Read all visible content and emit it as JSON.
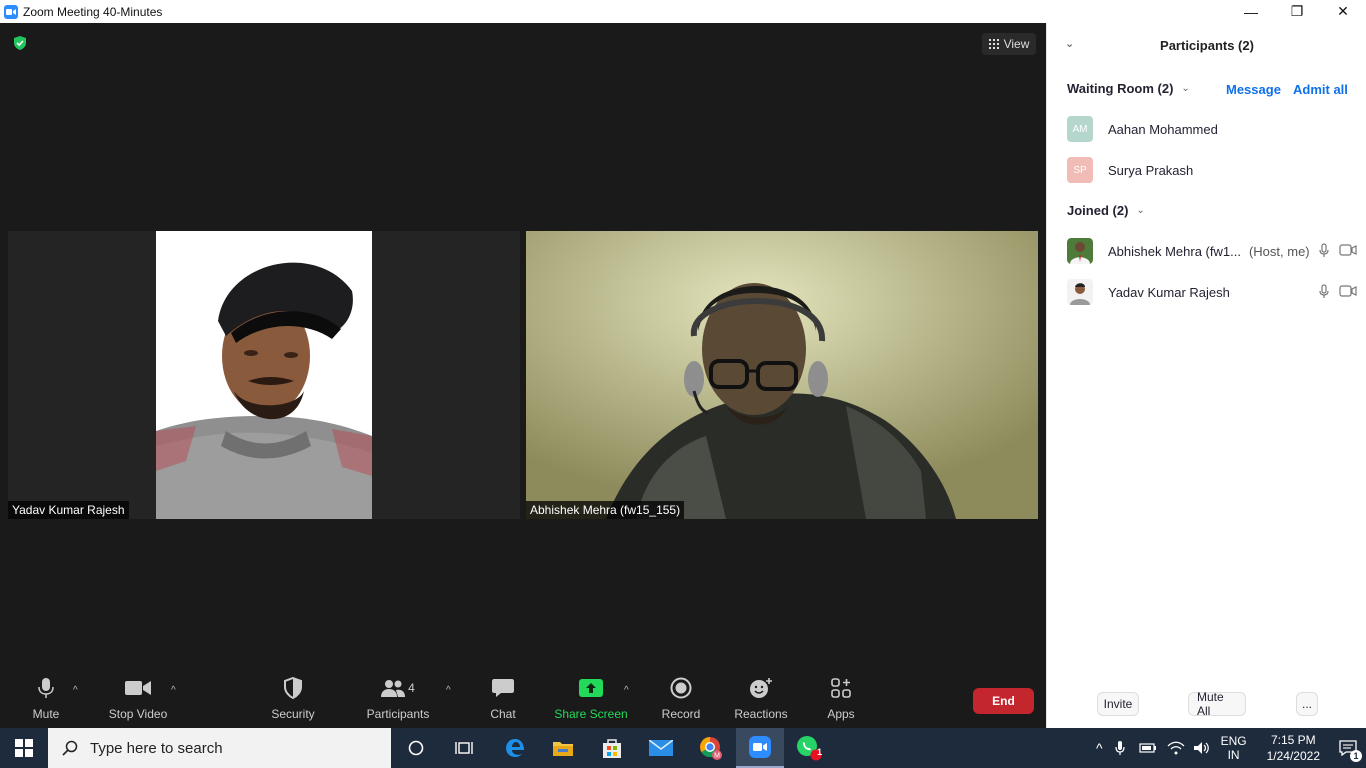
{
  "window": {
    "title": "Zoom Meeting 40-Minutes"
  },
  "meeting": {
    "view_label": "View",
    "tiles": [
      {
        "name": "Yadav Kumar Rajesh"
      },
      {
        "name": "Abhishek Mehra (fw15_155)"
      }
    ]
  },
  "toolbar": {
    "mute": "Mute",
    "stop_video": "Stop Video",
    "security": "Security",
    "participants": "Participants",
    "participants_count": "4",
    "chat": "Chat",
    "share_screen": "Share Screen",
    "record": "Record",
    "reactions": "Reactions",
    "apps": "Apps",
    "end": "End"
  },
  "panel": {
    "title": "Participants (2)",
    "waiting_room": {
      "title": "Waiting Room (2)",
      "message": "Message",
      "admit_all": "Admit all",
      "people": [
        {
          "initials": "AM",
          "name": "Aahan Mohammed",
          "color": "#b5d6cc"
        },
        {
          "initials": "SP",
          "name": "Surya Prakash",
          "color": "#f0bcb5"
        }
      ]
    },
    "joined": {
      "title": "Joined (2)",
      "people": [
        {
          "name": "Abhishek Mehra (fw1...",
          "role": "(Host, me)"
        },
        {
          "name": "Yadav Kumar Rajesh",
          "role": ""
        }
      ]
    },
    "footer": {
      "invite": "Invite",
      "mute_all": "Mute All",
      "more": "..."
    }
  },
  "taskbar": {
    "search_placeholder": "Type here to search",
    "lang_top": "ENG",
    "lang_bottom": "IN",
    "time": "7:15 PM",
    "date": "1/24/2022",
    "whatsapp_badge": "1",
    "notification_badge": "1"
  },
  "colors": {
    "zoom_blue": "#2d8cff",
    "end_red": "#c4262d",
    "share_green": "#23d959",
    "link_blue": "#0e71eb"
  }
}
